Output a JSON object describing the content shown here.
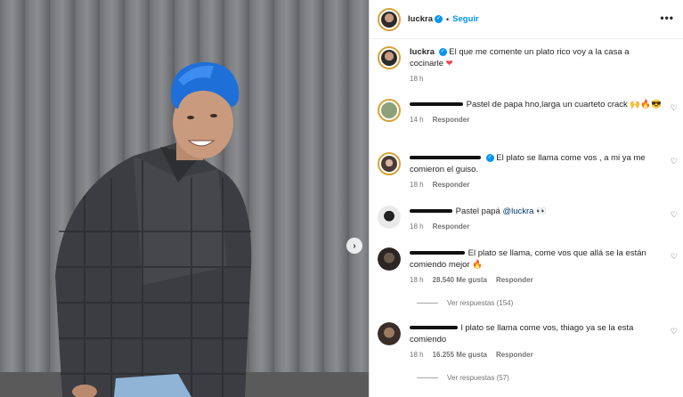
{
  "header": {
    "username": "luckra",
    "follow_label": "Seguir",
    "separator": "•",
    "more_icon": "more-icon"
  },
  "caption": {
    "username": "luckra",
    "text": "El que me comente un plato rico voy a la casa a cocinarle",
    "emoji": "❤",
    "time": "18 h"
  },
  "comments": [
    {
      "text": "Pastel de papa hno,larga un cuarteto crack 🙌🔥😎",
      "time": "14 h",
      "reply_label": "Responder"
    },
    {
      "text": "El plato se llama come vos , a mi ya me comieron el guiso.",
      "time": "18 h",
      "reply_label": "Responder"
    },
    {
      "text_before": "Pastel papá",
      "mention": "@luckra",
      "text_after": "👀",
      "time": "18 h",
      "reply_label": "Responder"
    },
    {
      "text": "El plato se llama, come vos que allá se la están comiendo mejor 🔥",
      "time": "18 h",
      "likes": "28.540 Me gusta",
      "reply_label": "Responder",
      "view_replies": "Ver respuestas (154)"
    },
    {
      "text": "l plato se llama come vos, thiago ya se la esta comiendo",
      "time": "18 h",
      "likes": "16.255 Me gusta",
      "reply_label": "Responder",
      "view_replies": "Ver respuestas (57)"
    }
  ],
  "colors": {
    "link_blue": "#0095f6",
    "hair_blue": "#1f6fd8",
    "heart_red": "#ed4956"
  }
}
